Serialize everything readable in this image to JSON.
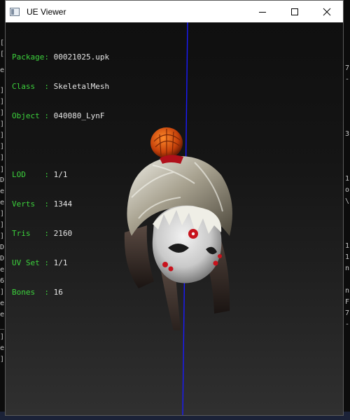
{
  "window": {
    "title": "UE Viewer"
  },
  "controls": {
    "minimize": "minimize",
    "maximize": "maximize",
    "close": "close"
  },
  "info": {
    "package": {
      "label": "Package:",
      "value": "00021025.upk"
    },
    "class": {
      "label": "Class  :",
      "value": "SkeletalMesh"
    },
    "object": {
      "label": "Object :",
      "value": "040080_LynF"
    },
    "lod": {
      "label": "LOD    :",
      "value": "1/1"
    },
    "verts": {
      "label": "Verts  :",
      "value": "1344"
    },
    "tris": {
      "label": "Tris   :",
      "value": "2160"
    },
    "uvset": {
      "label": "UV Set :",
      "value": "1/1"
    },
    "bones": {
      "label": "Bones  :",
      "value": "16"
    }
  },
  "colors": {
    "label_green": "#3cd23c",
    "axis_blue": "#1a1aff",
    "viewport_dark": "#0f0f0f"
  }
}
